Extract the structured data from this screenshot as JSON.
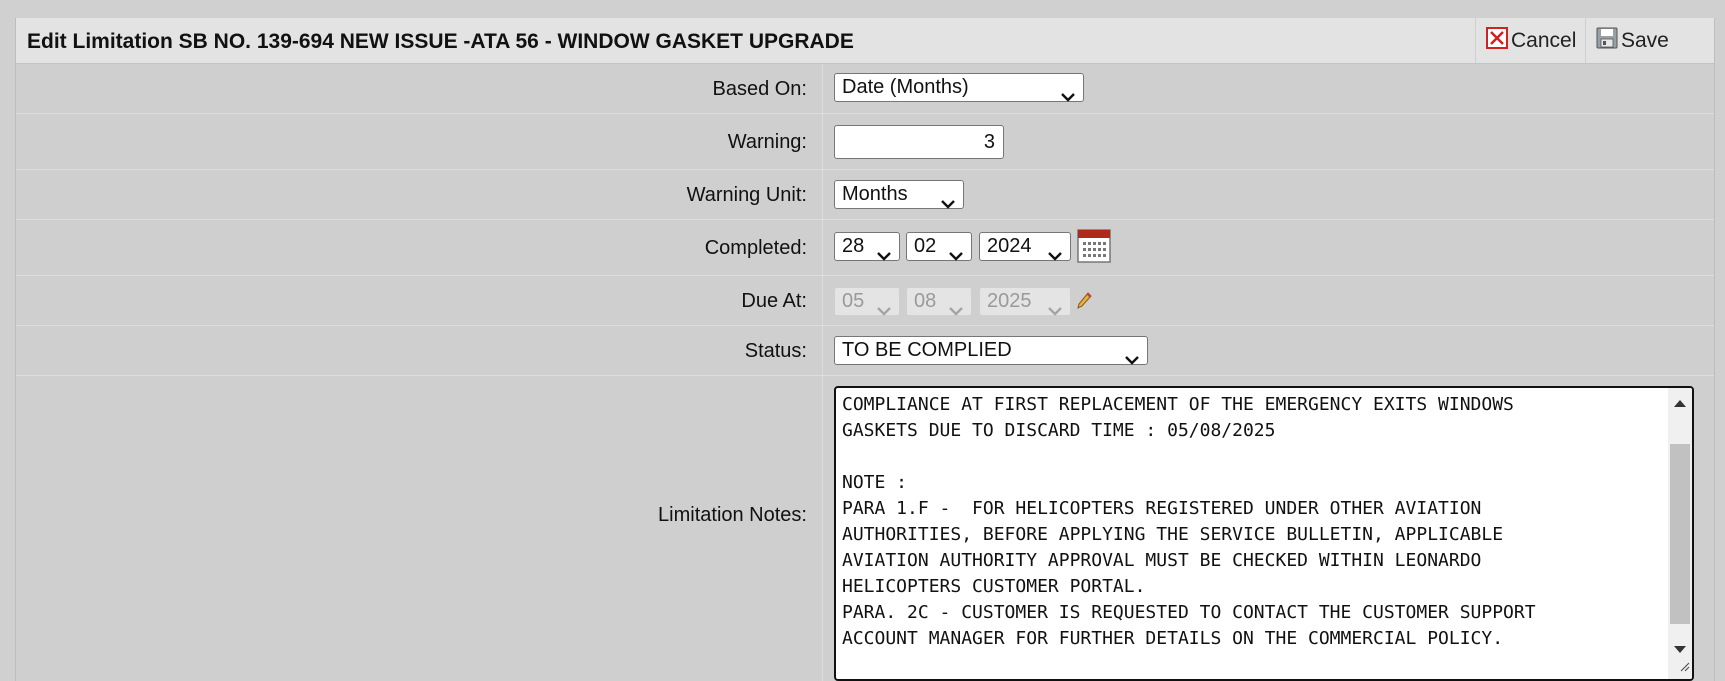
{
  "header": {
    "title": "Edit Limitation SB NO. 139-694 NEW ISSUE -ATA 56 - WINDOW GASKET UPGRADE",
    "cancel_label": "Cancel",
    "save_label": "Save"
  },
  "form": {
    "based_on": {
      "label": "Based On:",
      "value": "Date (Months)"
    },
    "warning": {
      "label": "Warning:",
      "value": "3"
    },
    "warning_unit": {
      "label": "Warning Unit:",
      "value": "Months"
    },
    "completed": {
      "label": "Completed:",
      "day": "28",
      "month": "02",
      "year": "2024"
    },
    "due_at": {
      "label": "Due At:",
      "day": "05",
      "month": "08",
      "year": "2025"
    },
    "status": {
      "label": "Status:",
      "value": "TO BE COMPLIED"
    },
    "limitation_notes": {
      "label": "Limitation Notes:",
      "value": "COMPLIANCE AT FIRST REPLACEMENT OF THE EMERGENCY EXITS WINDOWS\nGASKETS DUE TO DISCARD TIME : 05/08/2025\n\nNOTE :\nPARA 1.F -  FOR HELICOPTERS REGISTERED UNDER OTHER AVIATION\nAUTHORITIES, BEFORE APPLYING THE SERVICE BULLETIN, APPLICABLE\nAVIATION AUTHORITY APPROVAL MUST BE CHECKED WITHIN LEONARDO\nHELICOPTERS CUSTOMER PORTAL.\nPARA. 2C - CUSTOMER IS REQUESTED TO CONTACT THE CUSTOMER SUPPORT\nACCOUNT MANAGER FOR FURTHER DETAILS ON THE COMMERCIAL POLICY."
    }
  },
  "icons": {
    "cancel": "close-icon",
    "save": "floppy-disk-icon",
    "calendar": "calendar-icon",
    "edit": "pencil-icon"
  },
  "colors": {
    "cancel_red": "#d32020",
    "calendar_red": "#b0281c"
  }
}
